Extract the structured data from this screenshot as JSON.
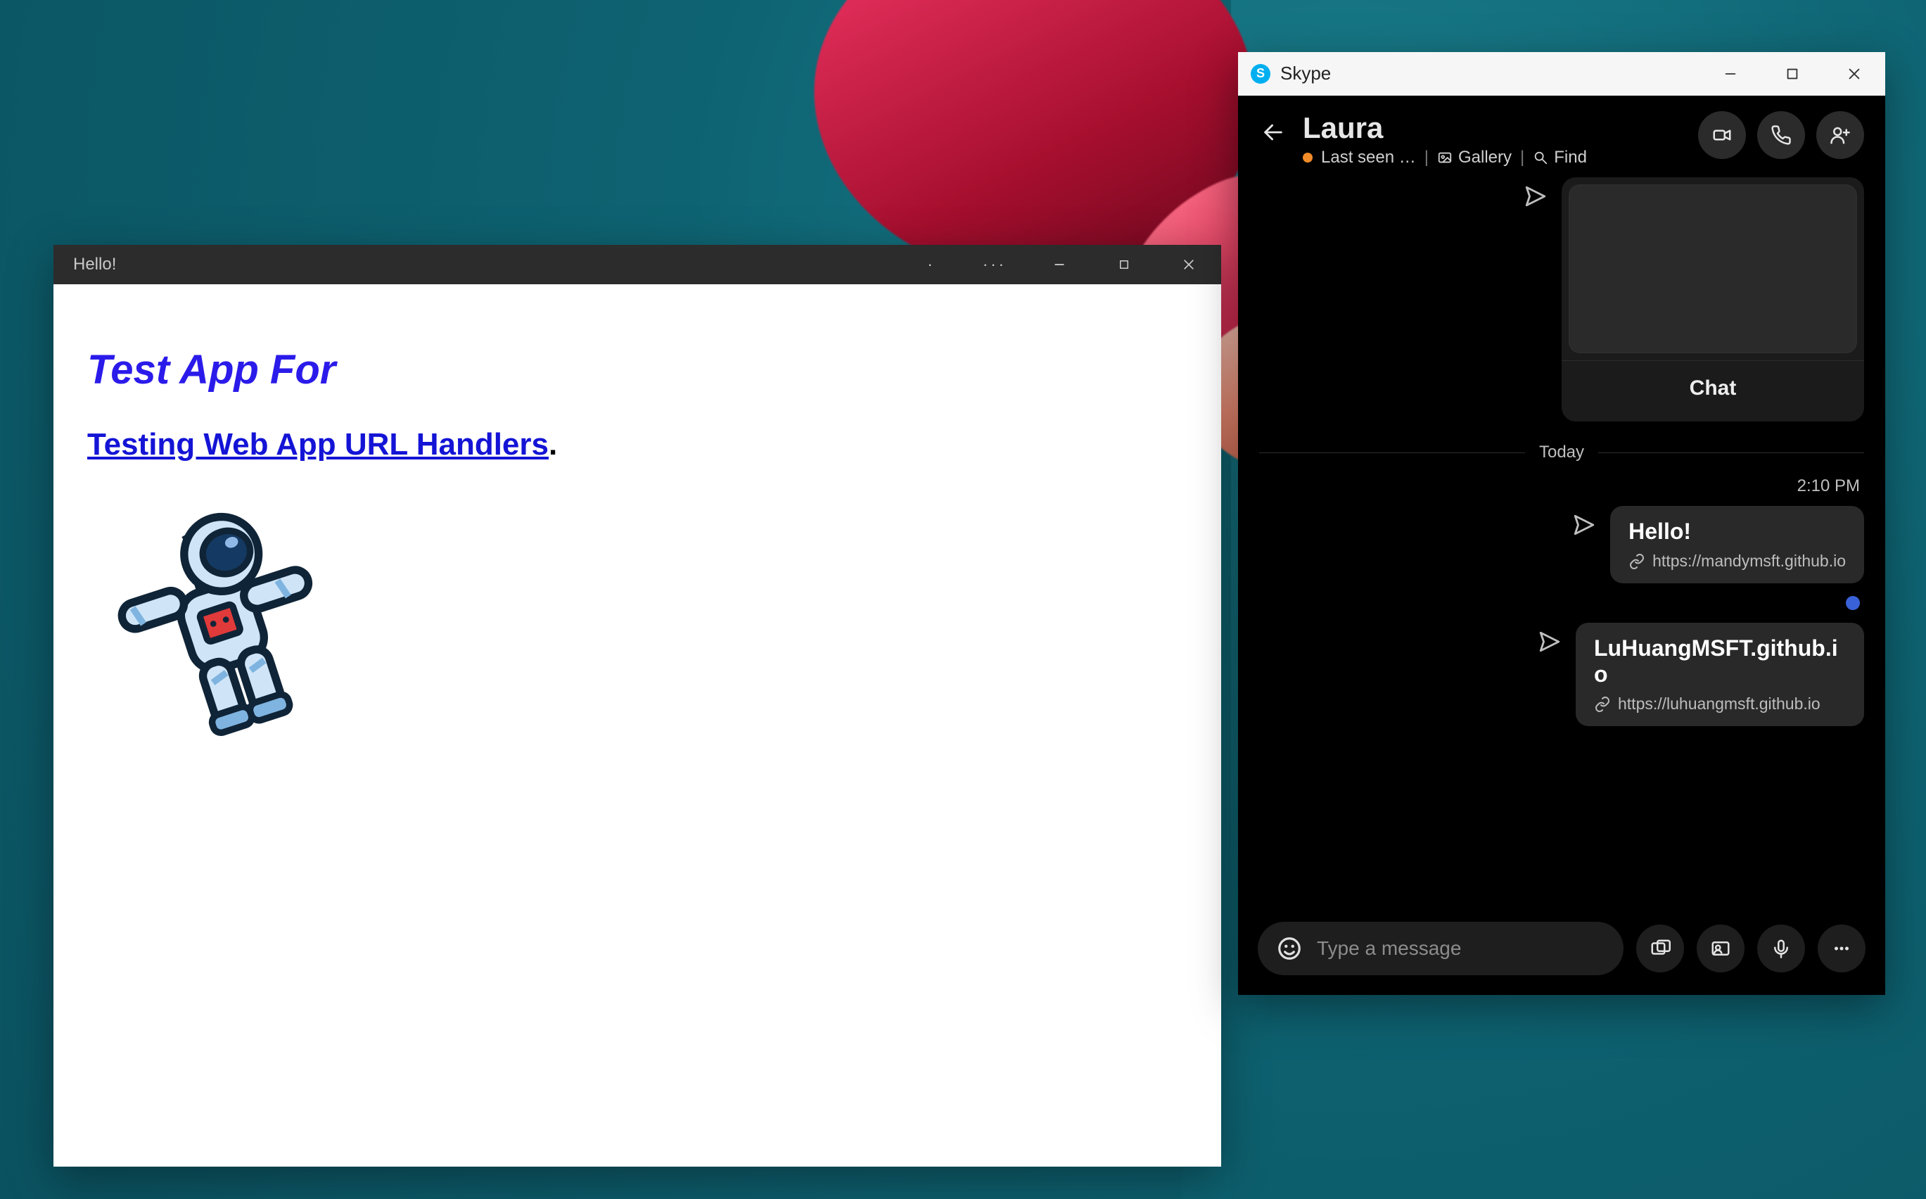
{
  "hello_window": {
    "title": "Hello!",
    "heading": "Test App For",
    "subheading_link": "Testing Web App URL Handlers",
    "subheading_period": "."
  },
  "skype_window": {
    "titlebar": {
      "app_name": "Skype"
    },
    "header": {
      "contact_name": "Laura",
      "last_seen": "Last seen …",
      "gallery_label": "Gallery",
      "find_label": "Find",
      "separator": "|"
    },
    "preview_card": {
      "caption": "Chat"
    },
    "day_separator": "Today",
    "time_stamp": "2:10 PM",
    "messages": [
      {
        "title": "Hello!",
        "url": "https://mandymsft.github.io"
      },
      {
        "title": "LuHuangMSFT.github.io",
        "url": "https://luhuangmsft.github.io"
      }
    ],
    "composer": {
      "placeholder": "Type a message"
    }
  }
}
